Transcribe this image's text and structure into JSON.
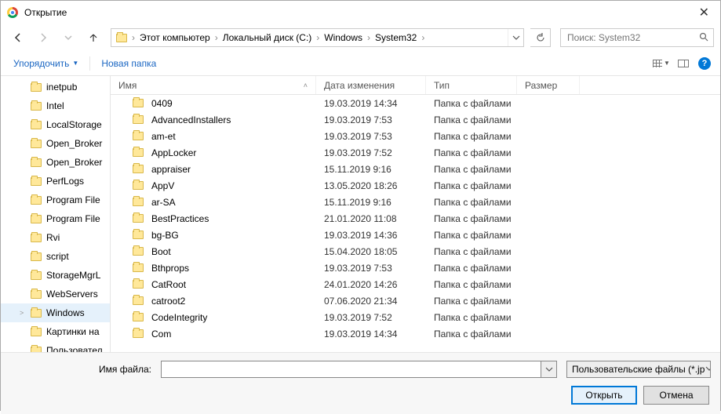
{
  "window": {
    "title": "Открытие"
  },
  "breadcrumbs": [
    "Этот компьютер",
    "Локальный диск (C:)",
    "Windows",
    "System32"
  ],
  "search": {
    "placeholder": "Поиск: System32"
  },
  "toolbar": {
    "organize": "Упорядочить",
    "new_folder": "Новая папка"
  },
  "columns": {
    "name": "Имя",
    "date": "Дата изменения",
    "type": "Тип",
    "size": "Размер"
  },
  "sidebar": [
    {
      "label": "inetpub"
    },
    {
      "label": "Intel"
    },
    {
      "label": "LocalStorage"
    },
    {
      "label": "Open_Broker"
    },
    {
      "label": "Open_Broker"
    },
    {
      "label": "PerfLogs"
    },
    {
      "label": "Program File"
    },
    {
      "label": "Program File"
    },
    {
      "label": "Rvi"
    },
    {
      "label": "script"
    },
    {
      "label": "StorageMgrL"
    },
    {
      "label": "WebServers"
    },
    {
      "label": "Windows",
      "selected": true,
      "expandable": true
    },
    {
      "label": "Картинки на"
    },
    {
      "label": "Пользовател"
    }
  ],
  "files": [
    {
      "name": "0409",
      "date": "19.03.2019 14:34",
      "type": "Папка с файлами"
    },
    {
      "name": "AdvancedInstallers",
      "date": "19.03.2019 7:53",
      "type": "Папка с файлами"
    },
    {
      "name": "am-et",
      "date": "19.03.2019 7:53",
      "type": "Папка с файлами"
    },
    {
      "name": "AppLocker",
      "date": "19.03.2019 7:52",
      "type": "Папка с файлами"
    },
    {
      "name": "appraiser",
      "date": "15.11.2019 9:16",
      "type": "Папка с файлами"
    },
    {
      "name": "AppV",
      "date": "13.05.2020 18:26",
      "type": "Папка с файлами"
    },
    {
      "name": "ar-SA",
      "date": "15.11.2019 9:16",
      "type": "Папка с файлами"
    },
    {
      "name": "BestPractices",
      "date": "21.01.2020 11:08",
      "type": "Папка с файлами"
    },
    {
      "name": "bg-BG",
      "date": "19.03.2019 14:36",
      "type": "Папка с файлами"
    },
    {
      "name": "Boot",
      "date": "15.04.2020 18:05",
      "type": "Папка с файлами"
    },
    {
      "name": "Bthprops",
      "date": "19.03.2019 7:53",
      "type": "Папка с файлами"
    },
    {
      "name": "CatRoot",
      "date": "24.01.2020 14:26",
      "type": "Папка с файлами"
    },
    {
      "name": "catroot2",
      "date": "07.06.2020 21:34",
      "type": "Папка с файлами"
    },
    {
      "name": "CodeIntegrity",
      "date": "19.03.2019 7:52",
      "type": "Папка с файлами"
    },
    {
      "name": "Com",
      "date": "19.03.2019 14:34",
      "type": "Папка с файлами"
    }
  ],
  "footer": {
    "filename_label": "Имя файла:",
    "filename_value": "",
    "filter": "Пользовательские файлы (*.jp",
    "open": "Открыть",
    "cancel": "Отмена"
  }
}
